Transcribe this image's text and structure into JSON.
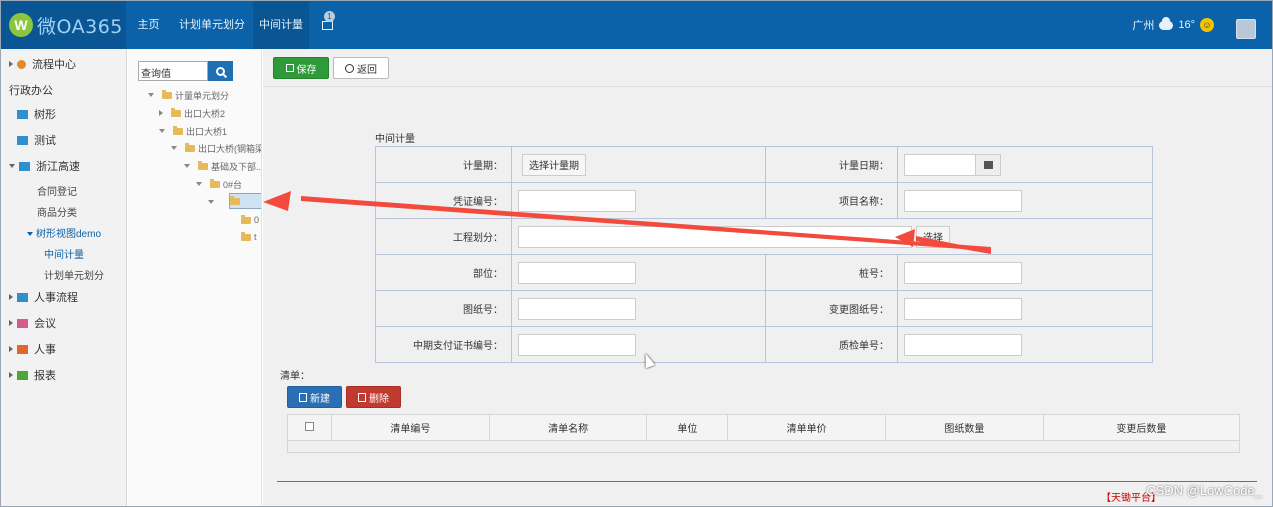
{
  "app": {
    "logo_text": "微OA365",
    "logo_mark": "W"
  },
  "topnav": {
    "items": [
      {
        "label": "主页"
      },
      {
        "label": "计划单元划分"
      },
      {
        "label": "中间计量"
      }
    ],
    "tab_badge": "1",
    "city": "广州",
    "temperature": "16°"
  },
  "sidebar": {
    "flow_center": "流程中心",
    "admin": "行政办公",
    "tree_shape": "树形",
    "test": "测试",
    "zhejiang_highway": "浙江高速",
    "contract_register": "合同登记",
    "goods_category": "商品分类",
    "tree_view_demo": "树形视图demo",
    "mid_measure": "中间计量",
    "plan_unit_split": "计划单元划分",
    "hr_flow": "人事流程",
    "meeting": "会议",
    "hr": "人事",
    "report": "报表"
  },
  "tree": {
    "search_value": "查询值",
    "nodes": {
      "root": "计量单元划分",
      "n1": "出口大桥2",
      "n2": "出口大桥1",
      "n3": "出口大桥(钢箱梁...",
      "n4": "基础及下部...",
      "n5": "0#台",
      "n6": "0",
      "n7": "t"
    }
  },
  "toolbar": {
    "save_label": "保存",
    "back_label": "返回"
  },
  "form": {
    "title": "中间计量",
    "period_label": "计量期：",
    "select_period_button": "选择计量期",
    "date_label": "计量日期：",
    "voucher_label": "凭证编号：",
    "project_name_label": "项目名称：",
    "engineering_label": "工程划分：",
    "select_button": "选择",
    "part_label": "部位：",
    "pile_label": "桩号：",
    "drawing_label": "图纸号：",
    "change_drawing_label": "变更图纸号：",
    "payment_cert_label": "中期支付证书编号：",
    "quality_label": "质检单号："
  },
  "list": {
    "title": "清单：",
    "new_button": "新建",
    "delete_button": "删除",
    "columns": [
      "清单编号",
      "清单名称",
      "单位",
      "清单单价",
      "图纸数量",
      "变更后数量"
    ]
  },
  "footer_text": "【天锄平台】",
  "watermark": "CSDN @LowCode_",
  "colors": {
    "nav": "#0b62a8",
    "save": "#2f9a3a",
    "new": "#2a6fb4",
    "delete": "#c13a2f",
    "annotation_arrow": "#f24a3d"
  }
}
